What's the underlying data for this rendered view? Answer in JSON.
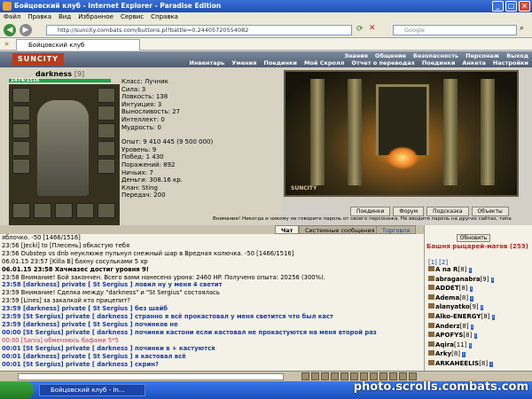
{
  "window": {
    "title": "Бойцовский клуб - Internet Explorer - Paradise Edition"
  },
  "menubar": [
    "Файл",
    "Правка",
    "Вид",
    "Избранное",
    "Сервис",
    "Справка"
  ],
  "address": {
    "url": "http://suncity.combats.com/buttons.pl?battle=0.24405720554082",
    "search_placeholder": "Google"
  },
  "tab": {
    "label": "Бойцовский клуб"
  },
  "game": {
    "logo": "SUNCITY",
    "top_menu_1": [
      "Знания",
      "Общение",
      "Безопасность",
      "Персонаж",
      "Выход"
    ],
    "top_menu_2": [
      "Инвентарь",
      "Умения",
      "Поединки",
      "Мой Скролл",
      "Отчет о переводах",
      "Поединки",
      "Анкета",
      "Настройки"
    ]
  },
  "character": {
    "name": "darkness",
    "level": "[9]",
    "hp": "1474/1516",
    "stats": [
      "Класс: Лучник",
      "Сила: 3",
      "Ловкость: 138",
      "Интуиция: 3",
      "Выносливость: 27",
      "Интеллект: 0",
      "Мудрость: 0"
    ],
    "info": [
      "Опыт: 9 410 445 (9 500 000)",
      "Уровень: 9",
      "Побед: 1 430",
      "Поражений: 892",
      "Ничьих: 7",
      "Деньги: 308.16 кр.",
      "Клан: Sting",
      "Передач: 200"
    ]
  },
  "scene_logo": "SUNCITY",
  "scene_buttons": [
    "Поединки",
    "Форум",
    "Подсказка",
    "Объекты"
  ],
  "warning": "Внимание! Никогда и никому не говорите пароль от своего персонажа. Не вводите пароль на других сайтах, типа",
  "chat_tabs": [
    "Чат",
    "Системные сообщения",
    "Торговля"
  ],
  "chat": [
    "яблочко. -50 [1466/1516]",
    "23:56 [Jecki] to [Плесень] обкастую тебя",
    "23:56 Dubstep vs dnb неуклюже пульнул снежный шар в Вредная колючка. -50 [1466/1516]",
    "06.01.15 23:57 [Killa B] бахну сосульками 5 хр",
    "06.01.15 23:58 Хачмазес достиг уровня 9!",
    "23:58 Внимание! Бой закончен. Всего вами нанесено урона: 2460 HP. Получено опыта: 20256 (300%).",
    "23:58 [darkness] private [ St Sergius ] ловил ну у меня 4 светит",
    "23:59 Внимание! Сделка между \"darkness\" и \"St Sergius\" состоялась",
    "23:59 [Lines] за закалкой кто прицепит?",
    "23:59 [darkness] private [ St Sergius ] без шайб",
    "23:59 [St Sergius] private [ darkness ] странно я всё прокастовал у меня светится что был каст",
    "23:59 [darkness] private [ St Sergius ] починков не",
    "00:00 [St Sergius] private [ darkness ] починки кастони если кастовал не прокастуются на меня второй раз",
    "00:00 [Sania] обменяюсь бафами 5*5",
    "00:01 [St Sergius] private [ darkness ] починки в + кастуются",
    "00:01 [darkness] private [ St Sergius ] я кастовал всё",
    "00:01 [St Sergius] private [ darkness ] скрин?"
  ],
  "sidebar": {
    "refresh_label": "Обновить",
    "tower_title": "Башня рыцарей-магов (253)",
    "pages": "[1] [2]",
    "roster": [
      {
        "name": "A na R",
        "level": "[8]"
      },
      {
        "name": "abraganabra",
        "level": "[9]"
      },
      {
        "name": "ADDET",
        "level": "[8]"
      },
      {
        "name": "Adema",
        "level": "[8]"
      },
      {
        "name": "alanyatko",
        "level": "[9]"
      },
      {
        "name": "Alko-ENERGY",
        "level": "[8]"
      },
      {
        "name": "Anderz",
        "level": "[8]"
      },
      {
        "name": "APOFYS",
        "level": "[8]"
      },
      {
        "name": "Aqira",
        "level": "[11]"
      },
      {
        "name": "Arky",
        "level": "[8]"
      },
      {
        "name": "ARKAHEELIS",
        "level": "[8]"
      }
    ]
  },
  "taskbar": {
    "task_label": "Бойцовский клуб - In..."
  },
  "watermark": "photo.scrolls.combats.com"
}
